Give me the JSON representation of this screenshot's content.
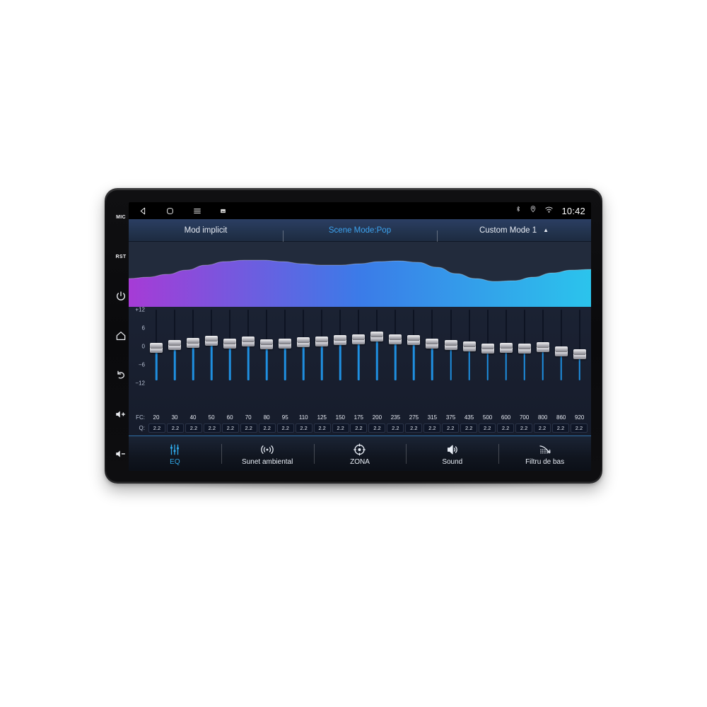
{
  "statusbar": {
    "nav": [
      {
        "icon": "back-triangle-icon"
      },
      {
        "icon": "home-square-icon"
      },
      {
        "icon": "menu-hamburger-icon"
      },
      {
        "icon": "screenshot-icon"
      }
    ],
    "indicators": [
      {
        "icon": "bluetooth-icon"
      },
      {
        "icon": "location-icon"
      },
      {
        "icon": "wifi-icon"
      }
    ],
    "clock": "10:42"
  },
  "hardware_keys": [
    {
      "label": "MIC",
      "type": "text",
      "name": "mic-key"
    },
    {
      "label": "RST",
      "type": "text",
      "name": "reset-key"
    },
    {
      "label": "",
      "type": "icon",
      "name": "power-key"
    },
    {
      "label": "",
      "type": "icon",
      "name": "home-key"
    },
    {
      "label": "",
      "type": "icon",
      "name": "back-key"
    },
    {
      "label": "",
      "type": "icon",
      "name": "volume-up-key"
    },
    {
      "label": "",
      "type": "icon",
      "name": "volume-down-key"
    }
  ],
  "mode_bar": {
    "items": [
      {
        "label": "Mod implicit",
        "active": false,
        "caret": ""
      },
      {
        "label": "Scene Mode:Pop",
        "active": true,
        "caret": ""
      },
      {
        "label": "Custom Mode 1",
        "active": false,
        "caret": "▲"
      }
    ]
  },
  "curve": {
    "gradient_start": "#A63BD6",
    "gradient_mid": "#3B7BE8",
    "gradient_end": "#2BC4EC",
    "points": [
      52,
      50,
      46,
      40,
      33,
      28,
      26,
      26,
      28,
      31,
      33,
      33,
      31,
      28,
      27,
      29,
      36,
      45,
      52,
      56,
      55,
      50,
      44,
      40,
      39
    ]
  },
  "equalizer": {
    "scale_labels": [
      "+12",
      "6",
      "0",
      "−6",
      "−12"
    ],
    "scale_min": -12,
    "scale_max": 12,
    "fc_label": "FC:",
    "q_label": "Q:",
    "bands": [
      {
        "fc": "20",
        "q": "2.2",
        "gain": -1.0
      },
      {
        "fc": "30",
        "q": "2.2",
        "gain": 0.0
      },
      {
        "fc": "40",
        "q": "2.2",
        "gain": 0.8
      },
      {
        "fc": "50",
        "q": "2.2",
        "gain": 1.4
      },
      {
        "fc": "60",
        "q": "2.2",
        "gain": 0.6
      },
      {
        "fc": "70",
        "q": "2.2",
        "gain": 1.2
      },
      {
        "fc": "80",
        "q": "2.2",
        "gain": 0.3
      },
      {
        "fc": "95",
        "q": "2.2",
        "gain": 0.4
      },
      {
        "fc": "110",
        "q": "2.2",
        "gain": 0.9
      },
      {
        "fc": "125",
        "q": "2.2",
        "gain": 1.1
      },
      {
        "fc": "150",
        "q": "2.2",
        "gain": 1.8
      },
      {
        "fc": "175",
        "q": "2.2",
        "gain": 2.0
      },
      {
        "fc": "200",
        "q": "2.2",
        "gain": 2.8
      },
      {
        "fc": "235",
        "q": "2.2",
        "gain": 1.9
      },
      {
        "fc": "275",
        "q": "2.2",
        "gain": 1.6
      },
      {
        "fc": "315",
        "q": "2.2",
        "gain": 0.4
      },
      {
        "fc": "375",
        "q": "2.2",
        "gain": 0.0
      },
      {
        "fc": "435",
        "q": "2.2",
        "gain": -0.4
      },
      {
        "fc": "500",
        "q": "2.2",
        "gain": -1.2
      },
      {
        "fc": "600",
        "q": "2.2",
        "gain": -1.0
      },
      {
        "fc": "700",
        "q": "2.2",
        "gain": -1.1
      },
      {
        "fc": "800",
        "q": "2.2",
        "gain": -0.6
      },
      {
        "fc": "860",
        "q": "2.2",
        "gain": -2.2
      },
      {
        "fc": "920",
        "q": "2.2",
        "gain": -3.0
      }
    ]
  },
  "bottom_nav": {
    "active_color": "#2fa8e8",
    "items": [
      {
        "label": "EQ",
        "icon": "equalizer-icon",
        "active": true
      },
      {
        "label": "Sunet ambiental",
        "icon": "surround-sound-icon",
        "active": false
      },
      {
        "label": "ZONA",
        "icon": "zone-target-icon",
        "active": false
      },
      {
        "label": "Sound",
        "icon": "speaker-icon",
        "active": false
      },
      {
        "label": "Filtru de bas",
        "icon": "bass-filter-icon",
        "active": false
      }
    ]
  }
}
